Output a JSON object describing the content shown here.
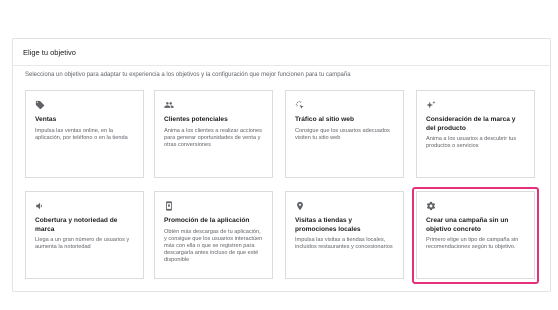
{
  "panel": {
    "title": "Elige tu objetivo",
    "subtitle": "Selecciona un objetivo para adaptar tu experiencia a los objetivos y la configuración que mejor funcionen para tu campaña"
  },
  "cards": [
    {
      "icon": "tag-icon",
      "title": "Ventas",
      "description": "Impulsa las ventas online, en la aplicación, por teléfono o en la tienda"
    },
    {
      "icon": "people-icon",
      "title": "Clientes potenciales",
      "description": "Anima a los clientes a realizar acciones para generar oportunidades de venta y otras conversiones"
    },
    {
      "icon": "cursor-click-icon",
      "title": "Tráfico al sitio web",
      "description": "Consigue que los usuarios adecuados visiten tu sitio web"
    },
    {
      "icon": "sparkle-icon",
      "title": "Consideración de la marca y del producto",
      "description": "Anima a los usuarios a descubrir tus productos o servicios"
    },
    {
      "icon": "megaphone-icon",
      "title": "Cobertura y notoriedad de marca",
      "description": "Llega a un gran número de usuarios y aumenta la notoriedad"
    },
    {
      "icon": "phone-icon",
      "title": "Promoción de la aplicación",
      "description": "Obtén más descargas de tu aplicación, y consigue que los usuarios interactúen más con ella o que se registren para descargarla antes incluso de que esté disponible"
    },
    {
      "icon": "location-pin-icon",
      "title": "Visitas a tiendas y promociones locales",
      "description": "Impulsa las visitas a tiendas locales, incluidos restaurantes y concesionarios"
    },
    {
      "icon": "gear-icon",
      "title": "Crear una campaña sin un objetivo concreto",
      "description": "Primero elige un tipo de campaña sin recomendaciones según tu objetivo."
    }
  ],
  "colors": {
    "highlight": "#e4317a",
    "icon": "#5f6368",
    "border": "#dadce0"
  }
}
